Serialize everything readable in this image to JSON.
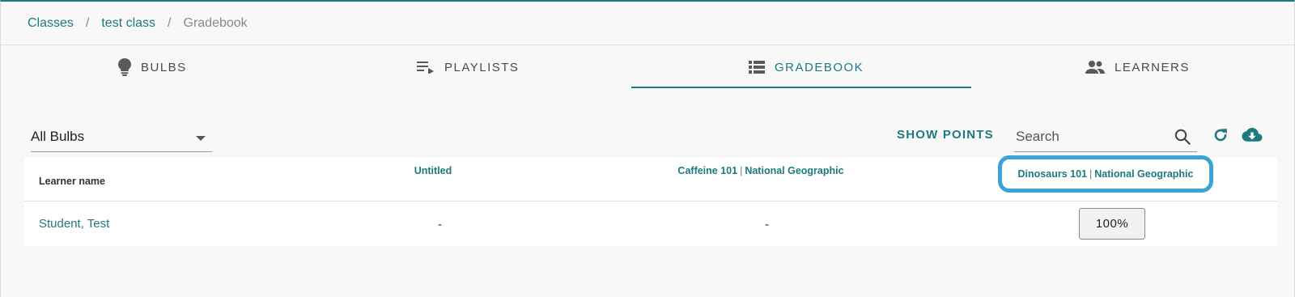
{
  "breadcrumb": {
    "classes": "Classes",
    "class_name": "test class",
    "current": "Gradebook",
    "separator": "/"
  },
  "tabs": [
    {
      "label": "BULBS",
      "icon": "bulb-icon"
    },
    {
      "label": "PLAYLISTS",
      "icon": "playlist-icon"
    },
    {
      "label": "GRADEBOOK",
      "icon": "list-icon",
      "active": true
    },
    {
      "label": "LEARNERS",
      "icon": "people-icon"
    }
  ],
  "toolbar": {
    "filter_value": "All Bulbs",
    "show_points_label": "SHOW POINTS",
    "search_placeholder": "Search"
  },
  "table": {
    "header_learner": "Learner name",
    "columns": [
      {
        "title": "Untitled"
      },
      {
        "title": "Caffeine 101",
        "source": "National Geographic"
      },
      {
        "title": "Dinosaurs 101",
        "source": "National Geographic",
        "highlighted": true
      }
    ],
    "column_separator": "|",
    "rows": [
      {
        "name": "Student, Test",
        "scores": [
          "-",
          "-",
          "100%"
        ]
      }
    ]
  },
  "colors": {
    "accent": "#1d7a7e",
    "highlight": "#3ba3d6"
  }
}
